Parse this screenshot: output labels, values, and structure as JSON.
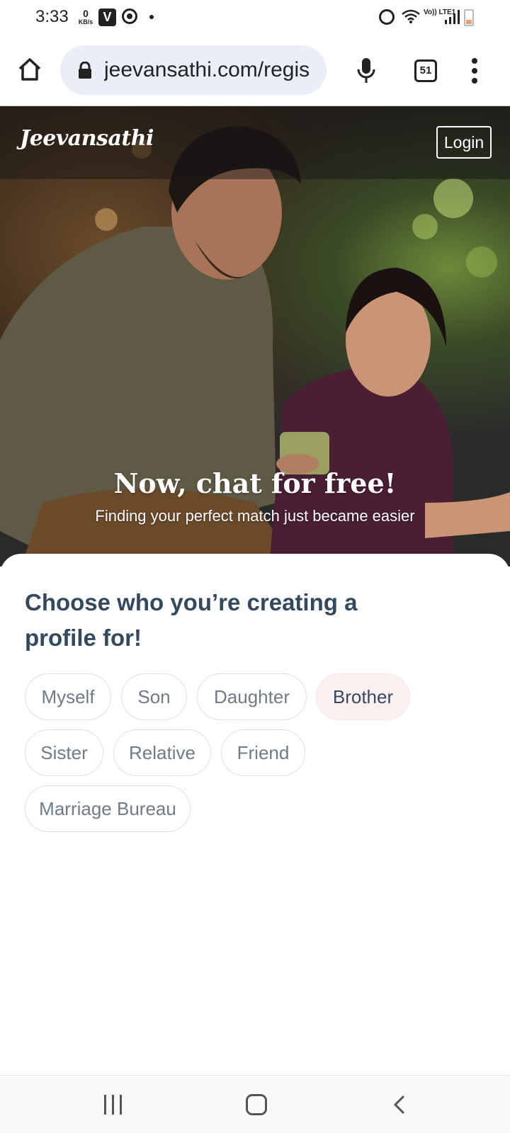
{
  "status_bar": {
    "time": "3:33",
    "data_rate_value": "0",
    "data_rate_unit": "KB/s",
    "network_label": "Vo)) LTE1",
    "carrier_badge": "V",
    "tab_count": "51"
  },
  "browser": {
    "url": "jeevansathi.com/regis"
  },
  "hero": {
    "brand": "Jeevansathi",
    "login_label": "Login",
    "title": "Now, chat for free!",
    "subtitle": "Finding your perfect match just became easier"
  },
  "profile_card": {
    "title": "Choose who you’re creating a profile for!",
    "options": [
      {
        "label": "Myself",
        "selected": false
      },
      {
        "label": "Son",
        "selected": false
      },
      {
        "label": "Daughter",
        "selected": false
      },
      {
        "label": "Brother",
        "selected": true
      },
      {
        "label": "Sister",
        "selected": false
      },
      {
        "label": "Relative",
        "selected": false
      },
      {
        "label": "Friend",
        "selected": false
      },
      {
        "label": "Marriage Bureau",
        "selected": false
      }
    ]
  },
  "colors": {
    "heading": "#34495e",
    "option_text": "#6f7b87",
    "selected_bg": "#fdf0f1",
    "url_pill_bg": "#e9eef8"
  },
  "icons": [
    "home-icon",
    "lock-icon",
    "mic-icon",
    "tabs-icon",
    "more-vert-icon",
    "alarm-icon",
    "wifi-icon",
    "signal-icon",
    "battery-icon",
    "recents-icon",
    "nav-home-icon",
    "back-icon"
  ]
}
